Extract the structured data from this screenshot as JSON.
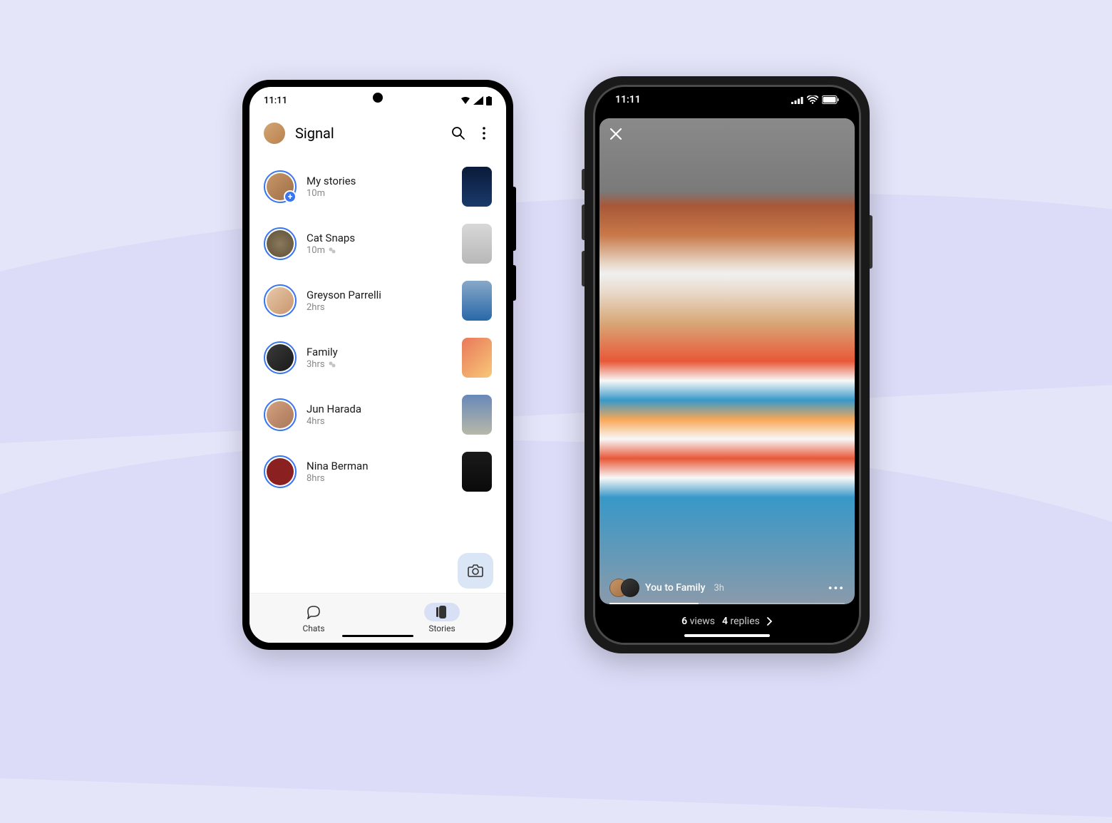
{
  "android": {
    "status_time": "11:11",
    "app_title": "Signal",
    "stories": [
      {
        "name": "My stories",
        "time": "10m",
        "has_add": true,
        "has_group": false
      },
      {
        "name": "Cat Snaps",
        "time": "10m",
        "has_add": false,
        "has_group": true
      },
      {
        "name": "Greyson Parrelli",
        "time": "2hrs",
        "has_add": false,
        "has_group": false
      },
      {
        "name": "Family",
        "time": "3hrs",
        "has_add": false,
        "has_group": true
      },
      {
        "name": "Jun Harada",
        "time": "4hrs",
        "has_add": false,
        "has_group": false
      },
      {
        "name": "Nina Berman",
        "time": "8hrs",
        "has_add": false,
        "has_group": false
      }
    ],
    "nav": {
      "chats": "Chats",
      "stories": "Stories"
    }
  },
  "iphone": {
    "status_time": "11:11",
    "story_author": "You to Family",
    "story_time": "3h",
    "views_count": "6",
    "views_label": "views",
    "replies_count": "4",
    "replies_label": "replies"
  }
}
